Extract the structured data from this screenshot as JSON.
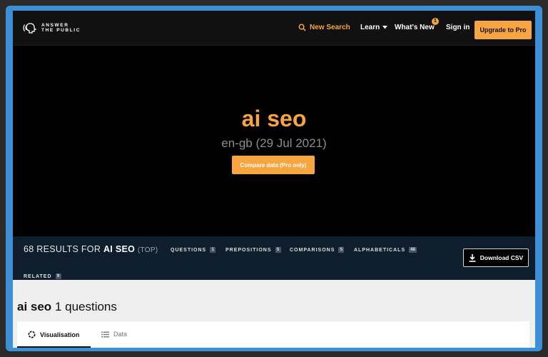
{
  "header": {
    "logo_line1": "ANSWER",
    "logo_line2": "THE PUBLIC",
    "new_search": "New Search",
    "learn": "Learn",
    "whats_new": "What's New",
    "whats_new_badge": "1",
    "sign_in": "Sign in",
    "upgrade": "Upgrade to Pro"
  },
  "hero": {
    "keyword": "ai seo",
    "subtitle": "en-gb (29 Jul 2021)",
    "compare_button": "Compare data (Pro only)"
  },
  "results": {
    "count_prefix": "68 RESULTS FOR",
    "keyword": "AI SEO",
    "scope": "(TOP)",
    "tabs": [
      {
        "label": "QUESTIONS",
        "count": "1"
      },
      {
        "label": "PREPOSITIONS",
        "count": "5"
      },
      {
        "label": "COMPARISONS",
        "count": "5"
      },
      {
        "label": "ALPHABETICALS",
        "count": "48"
      },
      {
        "label": "RELATED",
        "count": "9"
      }
    ],
    "download": "Download CSV"
  },
  "section": {
    "keyword": "ai seo",
    "suffix": "1 questions",
    "view_tabs": [
      "Visualisation",
      "Data"
    ]
  },
  "colors": {
    "accent": "#f7a541",
    "frame": "#3d8fd6",
    "results_bar": "#0e1e2c"
  },
  "icons": {
    "logo": "head-speech-icon",
    "new_search": "search-icon",
    "learn": "caret-down-icon",
    "download": "download-icon",
    "visualisation": "circle-dots-icon",
    "data": "list-icon"
  }
}
